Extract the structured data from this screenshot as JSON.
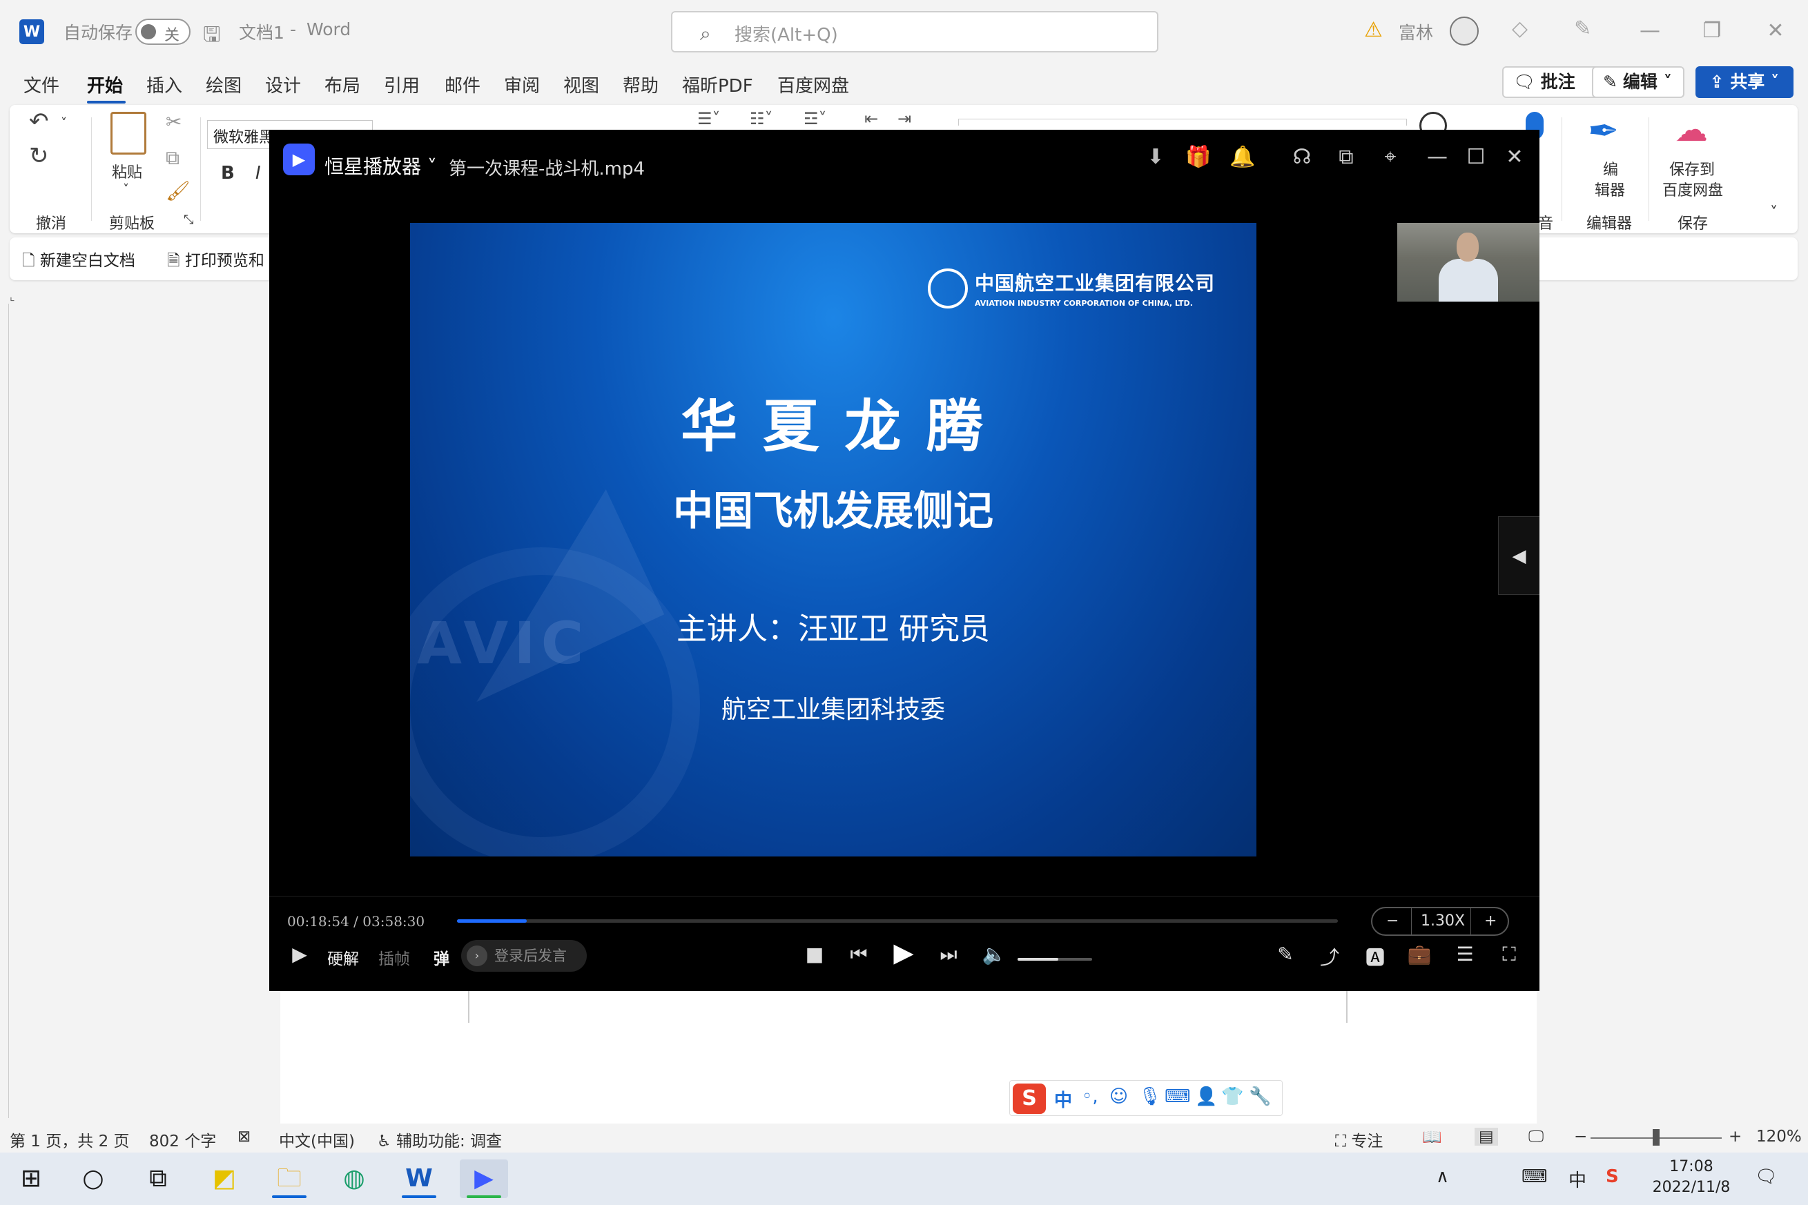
{
  "word": {
    "titlebar": {
      "logo_letter": "W",
      "autosave_label": "自动保存",
      "autosave_state": "关",
      "doc_title": "文档1",
      "title_separator": "-",
      "app_name": "Word",
      "search_placeholder": "搜索(Alt+Q)",
      "user_name": "富林"
    },
    "tabs": [
      "文件",
      "开始",
      "插入",
      "绘图",
      "设计",
      "布局",
      "引用",
      "邮件",
      "审阅",
      "视图",
      "帮助",
      "福昕PDF",
      "百度网盘"
    ],
    "active_tab": "开始",
    "comment_button": "批注",
    "edit_button": "编辑",
    "share_button": "共享",
    "ribbon": {
      "undo_group": "撤消",
      "paste_label": "粘贴",
      "clipboard_group": "剪贴板",
      "font_name": "微软雅黑",
      "bold": "B",
      "italic": "I",
      "editor_button_line1": "编",
      "editor_button_line2": "辑器",
      "editor_group": "编辑器",
      "save_to_baidu_line1": "保存到",
      "save_to_baidu_line2": "百度网盘",
      "save_group": "保存",
      "partial_group": "音"
    },
    "quickbar": {
      "new_blank": "新建空白文档",
      "print_preview": "打印预览和"
    },
    "statusbar": {
      "page_info": "第 1 页，共 2 页",
      "word_count": "802 个字",
      "language": "中文(中国)",
      "accessibility": "辅助功能: 调查",
      "focus": "专注",
      "zoom_minus": "−",
      "zoom_plus": "+",
      "zoom": "120%",
      "zoom_fraction": 0.5
    }
  },
  "player": {
    "app_name": "恒星播放器",
    "file_name": "第一次课程-战斗机.mp4",
    "slide": {
      "company_cn": "中国航空工业集团有限公司",
      "company_en": "AVIATION INDUSTRY CORPORATION OF CHINA, LTD.",
      "title": "华 夏 龙 腾",
      "subtitle": "中国飞机发展侧记",
      "speaker": "主讲人：汪亚卫  研究员",
      "org": "航空工业集团科技委",
      "watermark": "AVIC"
    },
    "current_time": "00:18:54",
    "total_time": "03:58:30",
    "progress_fraction": 0.079,
    "speed": "1.30X",
    "speed_minus": "−",
    "speed_plus": "+",
    "hw_decode": "硬解",
    "frame_insert": "插帧",
    "danmu_toggle": "弹",
    "danmu_placeholder": "登录后发言",
    "volume_fraction": 0.55
  },
  "ime": {
    "logo": "S",
    "mode": "中"
  },
  "taskbar": {
    "time": "17:08",
    "date": "2022/11/8",
    "ime_indicator": "中"
  },
  "colors": {
    "word_blue": "#185abd",
    "player_progress": "#1e6bff",
    "slide_blue": "#0a56b8"
  }
}
